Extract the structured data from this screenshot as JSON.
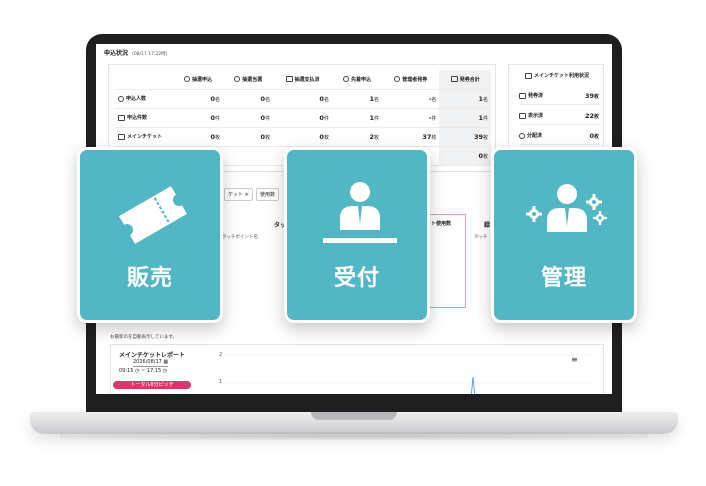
{
  "header": {
    "title": "申込状況",
    "timestamp": "(08/17 17:22時)"
  },
  "table": {
    "columns": [
      "抽選申込",
      "抽選当選",
      "抽選支払済",
      "先着申込",
      "管理者発券",
      "発券合計"
    ],
    "rows": [
      {
        "label": "申込人数",
        "cells": [
          {
            "n": "0",
            "u": "名"
          },
          {
            "n": "0",
            "u": "名"
          },
          {
            "n": "0",
            "u": "名"
          },
          {
            "n": "1",
            "u": "名"
          },
          {
            "n": "-",
            "u": "名"
          },
          {
            "n": "1",
            "u": "名"
          }
        ]
      },
      {
        "label": "申込件数",
        "cells": [
          {
            "n": "0",
            "u": "件"
          },
          {
            "n": "0",
            "u": "件"
          },
          {
            "n": "0",
            "u": "件"
          },
          {
            "n": "1",
            "u": "件"
          },
          {
            "n": "-",
            "u": "件"
          },
          {
            "n": "1",
            "u": "件"
          }
        ]
      },
      {
        "label": "メインチケット",
        "cells": [
          {
            "n": "0",
            "u": "枚"
          },
          {
            "n": "0",
            "u": "枚"
          },
          {
            "n": "0",
            "u": "枚"
          },
          {
            "n": "2",
            "u": "枚"
          },
          {
            "n": "37",
            "u": "枚"
          },
          {
            "n": "39",
            "u": "枚"
          }
        ]
      },
      {
        "label": "",
        "cells": [
          {
            "n": "",
            "u": ""
          },
          {
            "n": "",
            "u": ""
          },
          {
            "n": "-",
            "u": "枚"
          },
          {
            "n": "",
            "u": ""
          },
          {
            "n": "",
            "u": ""
          },
          {
            "n": "0",
            "u": "枚"
          }
        ]
      }
    ]
  },
  "side": {
    "title": "メインチケット利用状況",
    "rows": [
      {
        "label": "発券済",
        "value": "39",
        "unit": "枚"
      },
      {
        "label": "表示済",
        "value": "22",
        "unit": "枚"
      },
      {
        "label": "分配済",
        "value": "0",
        "unit": "枚"
      }
    ]
  },
  "filters": {
    "ticket": "ケット ≑",
    "used": "使用数"
  },
  "touch": {
    "title": "タッチポイ",
    "sub": "タッチポイント名",
    "pink_title": "ット使用数",
    "right_sub": "タッチ",
    "right_title": "録"
  },
  "report": {
    "note": "お最新のを自動表示しています。",
    "title": "メインチケットレポート",
    "date": "2026/08/17",
    "time_from": "09:15",
    "time_to": "17:15",
    "button": "トータル8分ピッチ",
    "y_top": "2",
    "y_mid": "1"
  },
  "tiles": [
    {
      "label": "販売",
      "icon": "ticket-icon"
    },
    {
      "label": "受付",
      "icon": "reception-person-icon"
    },
    {
      "label": "管理",
      "icon": "admin-gears-icon"
    }
  ],
  "colors": {
    "tile": "#52b6c4",
    "accent": "#d33b6b"
  }
}
